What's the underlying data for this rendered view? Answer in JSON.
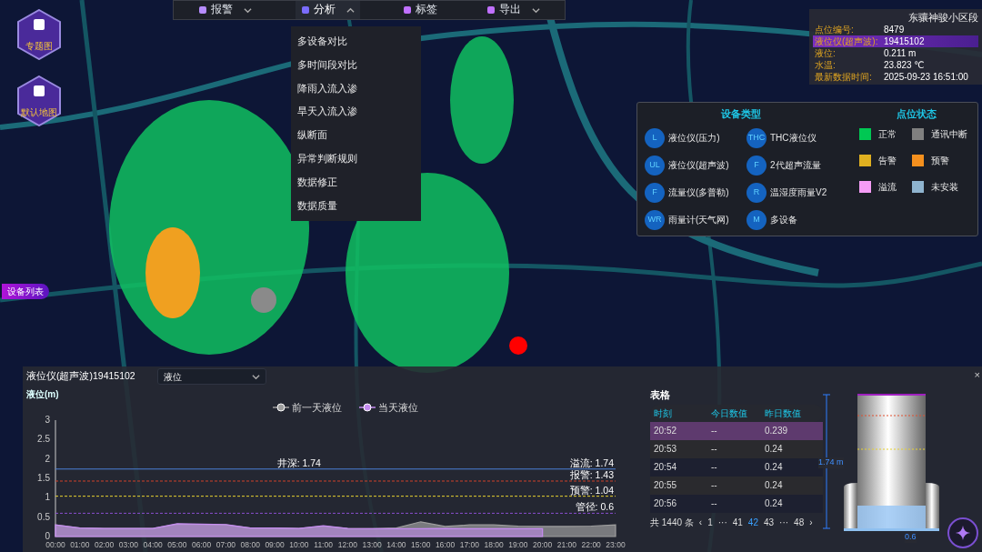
{
  "toolbar": {
    "items": [
      {
        "label": "报警",
        "dropdown": true,
        "expanded": false
      },
      {
        "label": "分析",
        "dropdown": true,
        "expanded": true
      },
      {
        "label": "标签",
        "dropdown": false,
        "expanded": false
      },
      {
        "label": "导出",
        "dropdown": true,
        "expanded": false
      }
    ]
  },
  "analysis_menu": {
    "items": [
      "多设备对比",
      "多时间段对比",
      "降雨入流入渗",
      "旱天入流入渗",
      "纵断面",
      "异常判断规则",
      "数据修正",
      "数据质量"
    ]
  },
  "map_buttons": [
    {
      "label": "专题图"
    },
    {
      "label": "默认地图"
    }
  ],
  "device_list_tab": {
    "label": "设备列表"
  },
  "info_panel": {
    "title": "东骧神骏小区段",
    "rows": [
      {
        "label": "点位编号:",
        "value": "8479",
        "highlighted": false
      },
      {
        "label": "液位仪(超声波):",
        "value": "19415102",
        "highlighted": true
      },
      {
        "label": "液位:",
        "value": "0.211 m",
        "highlighted": false
      },
      {
        "label": "水温:",
        "value": "23.823 ℃",
        "highlighted": false
      },
      {
        "label": "最新数据时间:",
        "value": "2025-09-23 16:51:00",
        "highlighted": false
      }
    ]
  },
  "legend": {
    "device_types_title": "设备类型",
    "device_types": [
      {
        "code": "L",
        "label": "液位仪(压力)"
      },
      {
        "code": "THC",
        "label": "THC液位仪"
      },
      {
        "code": "UL",
        "label": "液位仪(超声波)"
      },
      {
        "code": "F",
        "label": "2代超声流量"
      },
      {
        "code": "F",
        "label": "流量仪(多普勒)"
      },
      {
        "code": "R",
        "label": "温湿度雨量V2"
      },
      {
        "code": "WR",
        "label": "雨量计(天气网)"
      },
      {
        "code": "M",
        "label": "多设备"
      }
    ],
    "status_title": "点位状态",
    "statuses": [
      {
        "label": "正常",
        "color": "#00c853"
      },
      {
        "label": "通讯中断",
        "color": "#808080"
      },
      {
        "label": "告警",
        "color": "#e0b020"
      },
      {
        "label": "预警",
        "color": "#f5901e"
      },
      {
        "label": "溢流",
        "color": "#f59cf5"
      },
      {
        "label": "未安装",
        "color": "#8fb4cf"
      }
    ]
  },
  "device_panel": {
    "title": "液位仪(超声波)19415102",
    "metric_select": {
      "value": "液位"
    },
    "axis_title": "液位(m)",
    "chart_data": {
      "type": "area",
      "legend": "top",
      "categories": [
        "00:00",
        "01:00",
        "02:00",
        "03:00",
        "04:00",
        "05:00",
        "06:00",
        "07:00",
        "08:00",
        "09:00",
        "10:00",
        "11:00",
        "12:00",
        "13:00",
        "14:00",
        "15:00",
        "16:00",
        "17:00",
        "18:00",
        "19:00",
        "20:00",
        "21:00",
        "22:00",
        "23:00"
      ],
      "series": [
        {
          "name": "前一天液位",
          "color": "#9e9e9e",
          "values": [
            0.3,
            0.22,
            0.21,
            0.21,
            0.21,
            0.32,
            0.31,
            0.3,
            0.22,
            0.22,
            0.21,
            0.27,
            0.21,
            0.2,
            0.22,
            0.38,
            0.26,
            0.3,
            0.3,
            0.27,
            0.26,
            0.26,
            0.27,
            0.3
          ]
        },
        {
          "name": "当天液位",
          "color": "#c58cf0",
          "values": [
            0.3,
            0.22,
            0.21,
            0.21,
            0.21,
            0.33,
            0.32,
            0.31,
            0.22,
            0.22,
            0.21,
            0.28,
            0.21,
            0.2,
            0.2,
            0.2,
            0.21,
            0.2,
            0.2,
            0.2,
            0.2,
            null,
            null,
            null
          ]
        }
      ],
      "ylim": [
        0,
        3
      ],
      "yticks": [
        {
          "value": 0,
          "label": "0"
        },
        {
          "value": 0.5,
          "label": "0.5"
        },
        {
          "value": 1,
          "label": "1"
        },
        {
          "value": 1.5,
          "label": "1.5"
        },
        {
          "value": 2,
          "label": "2"
        },
        {
          "value": 2.5,
          "label": "2.5"
        },
        {
          "value": 3,
          "label": "3"
        }
      ],
      "ref_lines": [
        {
          "axis": "y",
          "value": 1.74,
          "label": "溢流: 1.74",
          "color": "#4a7fd6"
        },
        {
          "axis": "y",
          "value": 1.43,
          "label": "报警: 1.43",
          "color": "#d0402a"
        },
        {
          "axis": "y",
          "value": 1.04,
          "label": "预警: 1.04",
          "color": "#e6d030"
        },
        {
          "axis": "y",
          "value": 0.6,
          "label": "管径: 0.6",
          "color": "#8a4fd0"
        }
      ],
      "annotations": [
        {
          "text": "井深: 1.74",
          "x": "10:00",
          "y": 1.74
        }
      ]
    }
  },
  "table_panel": {
    "title": "表格",
    "columns": [
      "时刻",
      "今日数值",
      "昨日数值"
    ],
    "rows": [
      {
        "cells": [
          "20:52",
          "--",
          "0.239"
        ],
        "selected": true
      },
      {
        "cells": [
          "20:53",
          "--",
          "0.24"
        ],
        "selected": false
      },
      {
        "cells": [
          "20:54",
          "--",
          "0.24"
        ],
        "selected": false
      },
      {
        "cells": [
          "20:55",
          "--",
          "0.24"
        ],
        "selected": false
      },
      {
        "cells": [
          "20:56",
          "--",
          "0.24"
        ],
        "selected": false
      }
    ],
    "pagination": {
      "total": "共 1440 条",
      "prev": "‹",
      "next": "›",
      "pages": [
        {
          "label": "1",
          "selected": false
        },
        {
          "label": "···",
          "selected": false
        },
        {
          "label": "41",
          "selected": false
        },
        {
          "label": "42",
          "selected": true
        },
        {
          "label": "43",
          "selected": false
        },
        {
          "label": "···",
          "selected": false
        },
        {
          "label": "48",
          "selected": false
        }
      ]
    }
  },
  "tank": {
    "depth_label": "1.74 m",
    "pipe_label": "0.6",
    "close": "×"
  }
}
